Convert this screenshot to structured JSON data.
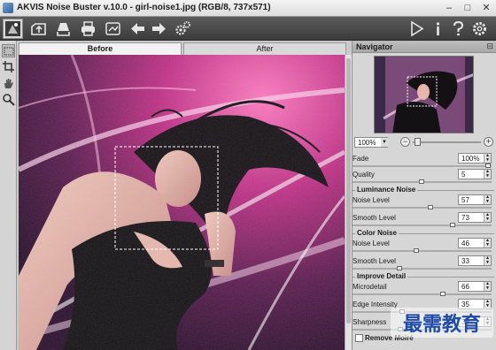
{
  "window": {
    "title": "AKVIS Noise Buster v.10.0 - girl-noise1.jpg (RGB/8, 737x571)",
    "minimize_icon": "minimize-icon",
    "maximize_icon": "maximize-icon",
    "close_icon": "close-icon"
  },
  "toolbar": {
    "left_icons": [
      "workspace-icon",
      "open-icon",
      "save-icon",
      "print-icon",
      "share-icon",
      "undo-icon",
      "redo-icon",
      "settings-icon"
    ],
    "right_icons": [
      "run-icon",
      "info-icon",
      "help-icon",
      "preferences-icon"
    ]
  },
  "tools": [
    "preview-window-tool-icon",
    "crop-tool-icon",
    "hand-tool-icon",
    "zoom-tool-icon"
  ],
  "tabs": {
    "before": "Before",
    "after": "After",
    "active": "before"
  },
  "navigator": {
    "title": "Navigator",
    "zoom": "100%",
    "zoom_out": "−",
    "zoom_in": "+",
    "zoom_level": 0.03
  },
  "params": {
    "fade": {
      "label": "Fade",
      "value": "100%",
      "level": 1.0
    },
    "quality": {
      "label": "Quality",
      "value": "5",
      "level": 0.5
    },
    "luminance_section": "Luminance Noise",
    "lum_noise_level": {
      "label": "Noise Level",
      "value": "57",
      "level": 0.57
    },
    "lum_smooth_level": {
      "label": "Smooth Level",
      "value": "73",
      "level": 0.73
    },
    "color_section": "Color Noise",
    "col_noise_level": {
      "label": "Noise Level",
      "value": "46",
      "level": 0.46
    },
    "col_smooth_level": {
      "label": "Smooth Level",
      "value": "33",
      "level": 0.33
    },
    "improve_section": "Improve Detail",
    "microdetail": {
      "label": "Microdetail",
      "value": "66",
      "level": 0.66
    },
    "edge_intensity": {
      "label": "Edge Intensity",
      "value": "35",
      "level": 0.35
    },
    "sharpness": {
      "label": "Sharpness",
      "value": "34",
      "level": 0.34
    },
    "remove_moire": {
      "label": "Remove Moiré",
      "checked": false
    }
  },
  "watermark": {
    "text": "最需教育"
  },
  "colors": {
    "toolbar_bg": "#4a4a4a",
    "panel_bg": "#d6d6d6",
    "accent_magenta": "#e0409a"
  }
}
